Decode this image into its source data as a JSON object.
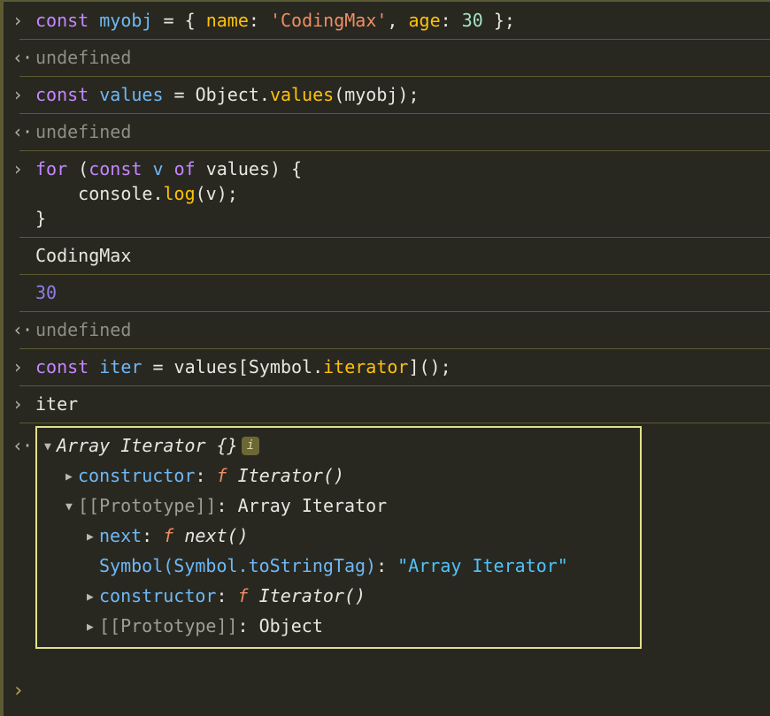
{
  "theme": {
    "background": "#282821",
    "separator": "#5c5a32",
    "text": "#e8e6df",
    "keyword": "#c586ff",
    "variable": "#6fb8f5",
    "property": "#ffc107",
    "string": "#f08d64",
    "number_literal": "#a5e3c0",
    "undefined": "#8e8e84",
    "logged_number": "#8f7fe8",
    "object_box_border": "#e3e08a",
    "info_badge_bg": "#6b6836",
    "cyan_string": "#4fc3f7",
    "prompt_caret": "#b5a84a"
  },
  "gutter_glyphs": {
    "input": "›",
    "output": "‹·",
    "prompt": "›",
    "triangle_collapsed": "▶",
    "triangle_expanded": "▼"
  },
  "rows": [
    {
      "kind": "input",
      "tokens": [
        {
          "t": "const",
          "c": "kw"
        },
        {
          "t": " ",
          "c": "plain"
        },
        {
          "t": "myobj",
          "c": "var"
        },
        {
          "t": " = { ",
          "c": "plain"
        },
        {
          "t": "name",
          "c": "prop"
        },
        {
          "t": ": ",
          "c": "plain"
        },
        {
          "t": "'CodingMax'",
          "c": "str"
        },
        {
          "t": ", ",
          "c": "plain"
        },
        {
          "t": "age",
          "c": "prop"
        },
        {
          "t": ": ",
          "c": "plain"
        },
        {
          "t": "30",
          "c": "num-lit"
        },
        {
          "t": " };",
          "c": "plain"
        }
      ]
    },
    {
      "kind": "output",
      "tokens": [
        {
          "t": "undefined",
          "c": "undef"
        }
      ]
    },
    {
      "kind": "input",
      "tokens": [
        {
          "t": "const",
          "c": "kw"
        },
        {
          "t": " ",
          "c": "plain"
        },
        {
          "t": "values",
          "c": "var"
        },
        {
          "t": " = Object.",
          "c": "plain"
        },
        {
          "t": "values",
          "c": "prop"
        },
        {
          "t": "(myobj);",
          "c": "plain"
        }
      ]
    },
    {
      "kind": "output",
      "tokens": [
        {
          "t": "undefined",
          "c": "undef"
        }
      ]
    },
    {
      "kind": "input",
      "tokens": [
        {
          "t": "for",
          "c": "kw"
        },
        {
          "t": " (",
          "c": "plain"
        },
        {
          "t": "const",
          "c": "kw"
        },
        {
          "t": " ",
          "c": "plain"
        },
        {
          "t": "v",
          "c": "var"
        },
        {
          "t": " ",
          "c": "plain"
        },
        {
          "t": "of",
          "c": "kw"
        },
        {
          "t": " values) {\n    console.",
          "c": "plain"
        },
        {
          "t": "log",
          "c": "prop"
        },
        {
          "t": "(v);\n}",
          "c": "plain"
        }
      ]
    },
    {
      "kind": "log",
      "tokens": [
        {
          "t": "CodingMax",
          "c": "plain"
        }
      ]
    },
    {
      "kind": "log",
      "tokens": [
        {
          "t": "30",
          "c": "lognum"
        }
      ]
    },
    {
      "kind": "output",
      "tokens": [
        {
          "t": "undefined",
          "c": "undef"
        }
      ]
    },
    {
      "kind": "input",
      "tokens": [
        {
          "t": "const",
          "c": "kw"
        },
        {
          "t": " ",
          "c": "plain"
        },
        {
          "t": "iter",
          "c": "var"
        },
        {
          "t": " = values[Symbol.",
          "c": "plain"
        },
        {
          "t": "iterator",
          "c": "prop"
        },
        {
          "t": "]();",
          "c": "plain"
        }
      ]
    },
    {
      "kind": "input",
      "tokens": [
        {
          "t": "iter",
          "c": "plain"
        }
      ]
    }
  ],
  "object_panel": {
    "gutter": "‹·",
    "info_badge": "i",
    "lines": [
      {
        "level": 0,
        "triangle": "▼",
        "has_badge": true,
        "tokens": [
          {
            "t": "Array Iterator {}",
            "c": "objtitle"
          }
        ]
      },
      {
        "level": 1,
        "triangle": "▶",
        "has_badge": false,
        "tokens": [
          {
            "t": "constructor",
            "c": "key"
          },
          {
            "t": ": ",
            "c": "colon"
          },
          {
            "t": "f",
            "c": "fn"
          },
          {
            "t": " ",
            "c": "white"
          },
          {
            "t": "Iterator()",
            "c": "fnname"
          }
        ]
      },
      {
        "level": 1,
        "triangle": "▼",
        "has_badge": false,
        "tokens": [
          {
            "t": "[[Prototype]]",
            "c": "keygray"
          },
          {
            "t": ": ",
            "c": "colon"
          },
          {
            "t": "Array Iterator",
            "c": "white"
          }
        ]
      },
      {
        "level": 2,
        "triangle": "▶",
        "has_badge": false,
        "tokens": [
          {
            "t": "next",
            "c": "key"
          },
          {
            "t": ": ",
            "c": "colon"
          },
          {
            "t": "f",
            "c": "fn"
          },
          {
            "t": " ",
            "c": "white"
          },
          {
            "t": "next()",
            "c": "fnname"
          }
        ]
      },
      {
        "level": 2,
        "triangle": " ",
        "has_badge": false,
        "tokens": [
          {
            "t": "Symbol(Symbol.toStringTag)",
            "c": "key"
          },
          {
            "t": ": ",
            "c": "colon"
          },
          {
            "t": "\"Array Iterator\"",
            "c": "cyanstr"
          }
        ]
      },
      {
        "level": 2,
        "triangle": "▶",
        "has_badge": false,
        "tokens": [
          {
            "t": "constructor",
            "c": "key"
          },
          {
            "t": ": ",
            "c": "colon"
          },
          {
            "t": "f",
            "c": "fn"
          },
          {
            "t": " ",
            "c": "white"
          },
          {
            "t": "Iterator()",
            "c": "fnname"
          }
        ]
      },
      {
        "level": 2,
        "triangle": "▶",
        "has_badge": false,
        "tokens": [
          {
            "t": "[[Prototype]]",
            "c": "keygray"
          },
          {
            "t": ": ",
            "c": "colon"
          },
          {
            "t": "Object",
            "c": "white"
          }
        ]
      }
    ]
  },
  "prompt": {
    "caret": "›",
    "value": "",
    "placeholder": ""
  }
}
